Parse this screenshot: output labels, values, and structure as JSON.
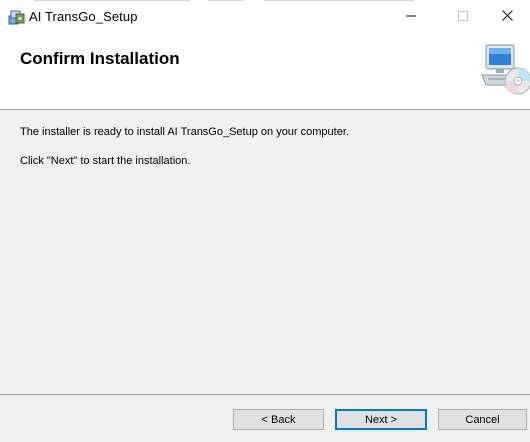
{
  "window": {
    "title": "AI TransGo_Setup"
  },
  "banner": {
    "title": "Confirm Installation"
  },
  "body": {
    "line1": "The installer is ready to install AI TransGo_Setup on your computer.",
    "line2": "Click \"Next\" to start the installation."
  },
  "footer": {
    "back_label": "< Back",
    "next_label": "Next >",
    "cancel_label": "Cancel"
  },
  "icons": {
    "app": "installer-package-icon",
    "minimize": "minimize-icon",
    "maximize": "maximize-icon",
    "close": "close-icon",
    "banner": "computer-cd-icon"
  },
  "colors": {
    "accent": "#0078d7",
    "panel": "#f0f0f0",
    "button": "#e1e1e1"
  }
}
